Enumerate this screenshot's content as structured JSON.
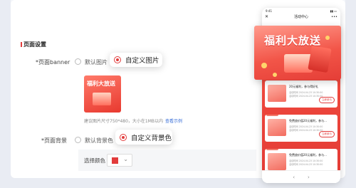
{
  "section": {
    "title": "页面设置"
  },
  "banner_field": {
    "label": "*页面banner",
    "option_default": "默认图片",
    "option_custom": "自定义图片",
    "hint": "建议图片尺寸750*480，大小在1MB以内",
    "hint_link": "查看示例",
    "thumb_title": "福利大放送"
  },
  "bg_field": {
    "label": "*页面背景",
    "option_default": "默认背景色",
    "option_custom": "自定义背景色",
    "color_label": "选择颜色",
    "color_value": "#e23b3b"
  },
  "phone": {
    "status_time": "9:41",
    "nav_title": "活动中心",
    "nav_close": "✕",
    "nav_more": "•••",
    "promo_title": "福利大放送",
    "cards": [
      {
        "title": "20元福利，参与得好礼",
        "meta1": "活动时间 2024.04.23 10:30:00",
        "meta2": "活动时间 2024.04.23 10:30:00",
        "button": "立即参与"
      },
      {
        "badge": "已完成",
        "title": "免费放价值20元福利，参与...",
        "meta1": "活动时间 2024.04.23 10:30:00",
        "meta2": "活动时间 2024.04.23 10:30:00",
        "button": "立即参与"
      },
      {
        "badge": "已完成",
        "title": "免费放价值20元福利，参与...",
        "meta1": "活动时间 2024.04.23 10:30:00",
        "meta2": "活动时间 2024.04.23 10:30:00",
        "button": ""
      }
    ],
    "back": "‹",
    "forward": "›"
  }
}
